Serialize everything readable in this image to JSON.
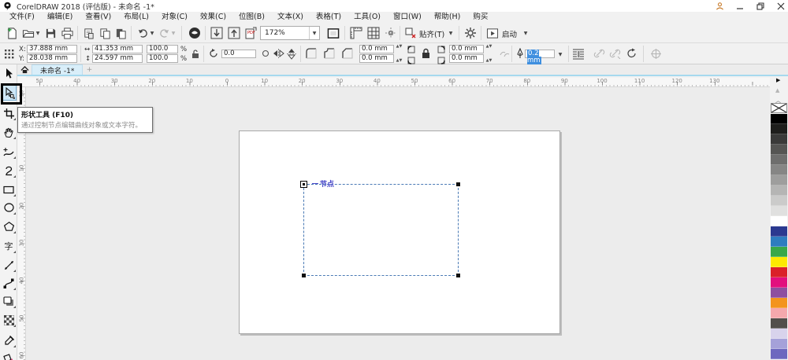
{
  "window": {
    "title": "CorelDRAW 2018 (评估版) - 未命名 -1*",
    "controls": [
      "sign-in",
      "minimize",
      "restore",
      "close"
    ]
  },
  "menu": {
    "items": [
      "文件(F)",
      "编辑(E)",
      "查看(V)",
      "布局(L)",
      "对象(C)",
      "效果(C)",
      "位图(B)",
      "文本(X)",
      "表格(T)",
      "工具(O)",
      "窗口(W)",
      "帮助(H)",
      "购买"
    ]
  },
  "toolbar": {
    "zoom_value": "172%",
    "snap_label": "贴齐(T)",
    "launch_label": "启动",
    "icons": [
      "new-document",
      "open",
      "save",
      "print",
      "cut",
      "copy",
      "paste",
      "undo",
      "redo",
      "search-content",
      "import",
      "export",
      "publish-pdf",
      "zoom-levels",
      "full-screen-preview",
      "show-rulers",
      "show-grid",
      "show-guidelines",
      "snap-to",
      "options-gear",
      "launch"
    ]
  },
  "property_bar": {
    "x_label": "X:",
    "x_value": "37.888 mm",
    "y_label": "Y:",
    "y_value": "28.038 mm",
    "width_value": "41.353 mm",
    "height_value": "24.597 mm",
    "scale_h": "100.0",
    "scale_v": "100.0",
    "percent_h": "%",
    "percent_v": "%",
    "rotation_value": "0.0",
    "corner_tl": "0.0 mm",
    "corner_bl": "0.0 mm",
    "corner_tr": "0.0 mm",
    "corner_br": "0.0 mm",
    "outline_value": "0.2 mm"
  },
  "document_tab": {
    "label": "未命名 -1*",
    "add_label": "+"
  },
  "rulers": {
    "horizontal_labels": [
      "50",
      "40",
      "30",
      "20",
      "10",
      "0",
      "10",
      "20",
      "30",
      "40",
      "50",
      "60",
      "70",
      "80",
      "90",
      "100",
      "110",
      "120",
      "130"
    ],
    "vertical_labels": [
      "10",
      "0",
      "10",
      "20",
      "30",
      "40",
      "50",
      "60"
    ]
  },
  "toolbox": {
    "selected": "shape-tool",
    "tools": [
      "pick-tool",
      "shape-tool",
      "crop-tool",
      "pan-tool",
      "artistic-media-tool",
      "curve-tool",
      "rectangle-tool",
      "ellipse-tool",
      "polygon-tool",
      "text-tool",
      "dimension-tool",
      "connector-tool",
      "drop-shadow-tool",
      "transparency-tool",
      "eyedropper-tool",
      "smart-fill-tool"
    ],
    "text_tool_glyph": "字"
  },
  "tooltip": {
    "title": "形状工具 (F10)",
    "description": "通过控制节点编辑曲线对象或文本字符。"
  },
  "canvas": {
    "node_label": "节点"
  },
  "palette": {
    "colors": [
      {
        "name": "black",
        "hex": "#000000"
      },
      {
        "name": "gray-90",
        "hex": "#1e1e1c"
      },
      {
        "name": "gray-80",
        "hex": "#3a3a39"
      },
      {
        "name": "gray-70",
        "hex": "#555553"
      },
      {
        "name": "gray-60",
        "hex": "#6e6e6d"
      },
      {
        "name": "gray-50",
        "hex": "#868685"
      },
      {
        "name": "gray-40",
        "hex": "#9e9e9d"
      },
      {
        "name": "gray-30",
        "hex": "#b5b5b4"
      },
      {
        "name": "gray-20",
        "hex": "#cbcbca"
      },
      {
        "name": "gray-10",
        "hex": "#e0e0df"
      },
      {
        "name": "white",
        "hex": "#ffffff"
      },
      {
        "name": "blue",
        "hex": "#2b3990"
      },
      {
        "name": "cyan-blue",
        "hex": "#2e7dc0"
      },
      {
        "name": "green",
        "hex": "#39a849"
      },
      {
        "name": "yellow",
        "hex": "#fde900"
      },
      {
        "name": "red",
        "hex": "#da2128"
      },
      {
        "name": "magenta",
        "hex": "#e20f7e"
      },
      {
        "name": "purple",
        "hex": "#8e4fa0"
      },
      {
        "name": "orange",
        "hex": "#f3941e"
      },
      {
        "name": "pink",
        "hex": "#f5a8ad"
      },
      {
        "name": "dark-gray",
        "hex": "#514f4b"
      },
      {
        "name": "lavender",
        "hex": "#d8d3ec"
      },
      {
        "name": "periwinkle",
        "hex": "#a5a1d9"
      },
      {
        "name": "violet",
        "hex": "#6d68bf"
      }
    ]
  }
}
